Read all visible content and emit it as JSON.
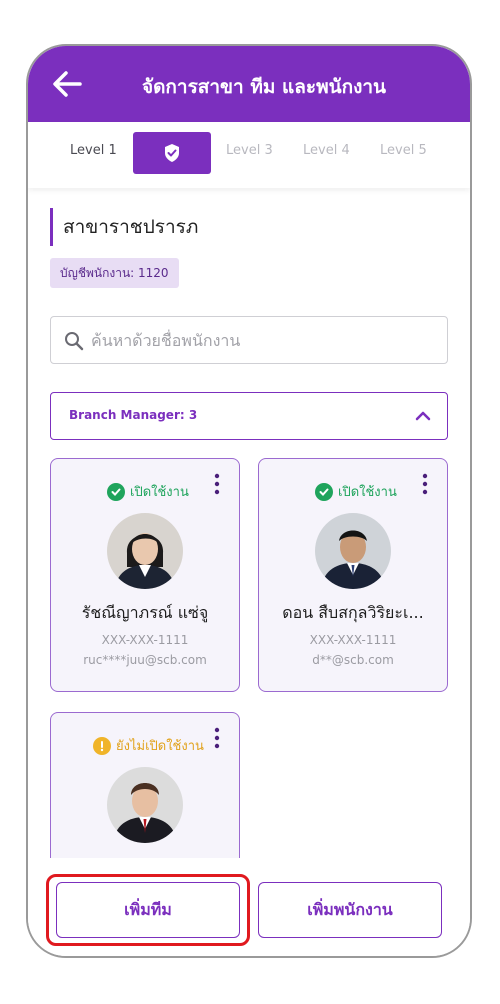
{
  "header": {
    "title": "จัดการสาขา ทีม และพนักงาน"
  },
  "tabs": [
    {
      "label": "Level 1",
      "state": "done"
    },
    {
      "label": "",
      "state": "active",
      "icon": "shield-check-icon"
    },
    {
      "label": "Level 3",
      "state": "pending"
    },
    {
      "label": "Level 4",
      "state": "pending"
    },
    {
      "label": "Level 5",
      "state": "pending"
    }
  ],
  "branch": {
    "name": "สาขาราชปรารภ",
    "account_badge": "บัญชีพนักงาน: 1120"
  },
  "search": {
    "placeholder": "ค้นหาด้วยชื่อพนักงาน",
    "value": ""
  },
  "group": {
    "label": "Branch Manager: 3",
    "expanded": true
  },
  "employees": [
    {
      "status": "เปิดใช้งาน",
      "status_type": "active",
      "name": "รัชณีญาภรณ์ แซ่จู",
      "phone": "XXX-XXX-1111",
      "email": "ruc****juu@scb.com"
    },
    {
      "status": "เปิดใช้งาน",
      "status_type": "active",
      "name": "ดอน สืบสกุลวิริยะเ...",
      "phone": "XXX-XXX-1111",
      "email": "d**@scb.com"
    },
    {
      "status": "ยังไม่เปิดใช้งาน",
      "status_type": "inactive",
      "name": "",
      "phone": "",
      "email": ""
    }
  ],
  "actions": {
    "add_team": "เพิ่มทีม",
    "add_employee": "เพิ่มพนักงาน"
  },
  "colors": {
    "brand": "#7b2fbe",
    "active": "#1fa45c",
    "inactive": "#e1a21b",
    "highlight": "#e0191f"
  }
}
